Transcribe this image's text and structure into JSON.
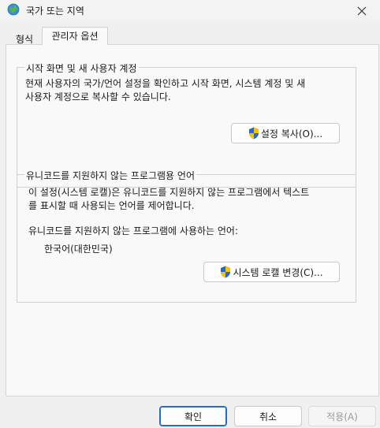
{
  "window": {
    "title": "국가 또는 지역"
  },
  "tabs": [
    {
      "label": "형식",
      "active": false
    },
    {
      "label": "관리자 옵션",
      "active": true
    }
  ],
  "welcome_group": {
    "legend": "시작 화면 및 새 사용자 계정",
    "description_line1": "현재 사용자의 국가/언어 설정을 확인하고 시작 화면, 시스템 계정 및 새",
    "description_line2": "사용자 계정으로 복사할 수 있습니다.",
    "copy_button": "설정 복사(O)..."
  },
  "unicode_group": {
    "legend": "유니코드를 지원하지 않는 프로그램용 언어",
    "description_line1": "이 설정(시스템 로캘)은 유니코드를 지원하지 않는 프로그램에서 텍스트",
    "description_line2": "를 표시할 때 사용되는 언어를 제어합니다.",
    "current_label": "유니코드를 지원하지 않는 프로그램에 사용하는 언어:",
    "current_value": "한국어(대한민국)",
    "change_button": "시스템 로캘 변경(C)..."
  },
  "footer": {
    "ok": "확인",
    "cancel": "취소",
    "apply": "적용(A)"
  },
  "colors": {
    "accent": "#1f6ecc",
    "shield_blue": "#2b67c9",
    "shield_yellow": "#f5c400"
  },
  "icons": [
    "globe-icon",
    "close-icon",
    "uac-shield-icon"
  ]
}
